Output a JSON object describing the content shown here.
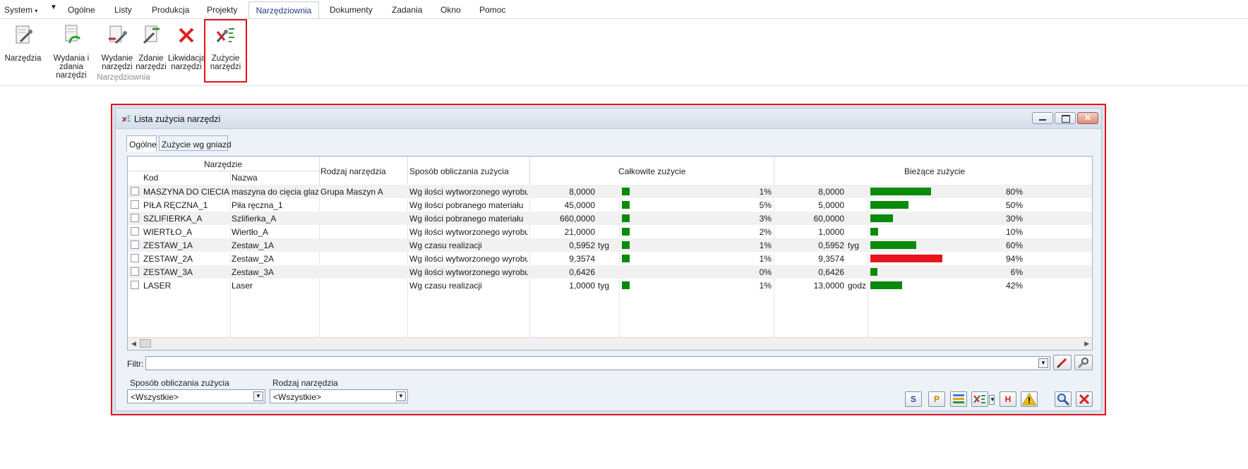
{
  "menu": {
    "system": "System",
    "items": [
      "Ogólne",
      "Listy",
      "Produkcja",
      "Projekty",
      "Narzędziownia",
      "Dokumenty",
      "Zadania",
      "Okno",
      "Pomoc"
    ]
  },
  "ribbon": {
    "buttons": [
      {
        "line1": "Narzędzia",
        "line2": ""
      },
      {
        "line1": "Wydania i",
        "line2": "zdania narzędzi"
      },
      {
        "line1": "Wydanie",
        "line2": "narzędzi"
      },
      {
        "line1": "Zdanie",
        "line2": "narzędzi"
      },
      {
        "line1": "Likwidacja",
        "line2": "narzędzi"
      },
      {
        "line1": "Zużycie",
        "line2": "narzędzi"
      }
    ],
    "group_label": "Narzędziownia"
  },
  "window": {
    "title": "Lista zużycia narzędzi",
    "tabs": [
      "Ogólne",
      "Zużycie wg gniazd"
    ],
    "columns": {
      "group": "Narzędzie",
      "kod": "Kod",
      "nazwa": "Nazwa",
      "rodzaj": "Rodzaj narzędzia",
      "sposob": "Sposób obliczania zużycia",
      "calkowite": "Całkowite zużycie",
      "biezace": "Bieżące zużycie"
    },
    "rows": [
      {
        "kod": "MASZYNA DO CIECIA GL",
        "nazwa": "maszyna do cięcia glazur",
        "rodzaj": "Grupa Maszyn A",
        "sposob": "Wg ilości wytworzonego wyrobu",
        "calk_val": "8,0000",
        "calk_unit": "",
        "calk_pct": "1%",
        "calk_frac": 0.01,
        "calk_color": "#0a8a0a",
        "biez_val": "8,0000",
        "biez_unit": "",
        "biez_pct": "80%",
        "biez_frac": 0.8,
        "biez_color": "#0a8a0a"
      },
      {
        "kod": "PIŁA RĘCZNA_1",
        "nazwa": "Piła ręczna_1",
        "rodzaj": "",
        "sposob": "Wg ilości pobranego materiału",
        "calk_val": "45,0000",
        "calk_unit": "",
        "calk_pct": "5%",
        "calk_frac": 0.05,
        "calk_color": "#0a8a0a",
        "biez_val": "5,0000",
        "biez_unit": "",
        "biez_pct": "50%",
        "biez_frac": 0.5,
        "biez_color": "#0a8a0a"
      },
      {
        "kod": "SZLIFIERKA_A",
        "nazwa": "Szlifierka_A",
        "rodzaj": "",
        "sposob": "Wg ilości pobranego materiału",
        "calk_val": "660,0000",
        "calk_unit": "",
        "calk_pct": "3%",
        "calk_frac": 0.03,
        "calk_color": "#0a8a0a",
        "biez_val": "60,0000",
        "biez_unit": "",
        "biez_pct": "30%",
        "biez_frac": 0.3,
        "biez_color": "#0a8a0a"
      },
      {
        "kod": "WIERTŁO_A",
        "nazwa": "Wiertło_A",
        "rodzaj": "",
        "sposob": "Wg ilości wytworzonego wyrobu",
        "calk_val": "21,0000",
        "calk_unit": "",
        "calk_pct": "2%",
        "calk_frac": 0.02,
        "calk_color": "#0a8a0a",
        "biez_val": "1,0000",
        "biez_unit": "",
        "biez_pct": "10%",
        "biez_frac": 0.1,
        "biez_color": "#0a8a0a"
      },
      {
        "kod": "ZESTAW_1A",
        "nazwa": "Zestaw_1A",
        "rodzaj": "",
        "sposob": "Wg czasu realizacji",
        "calk_val": "0,5952",
        "calk_unit": "tyg",
        "calk_pct": "1%",
        "calk_frac": 0.01,
        "calk_color": "#0a8a0a",
        "biez_val": "0,5952",
        "biez_unit": "tyg",
        "biez_pct": "60%",
        "biez_frac": 0.6,
        "biez_color": "#0a8a0a"
      },
      {
        "kod": "ZESTAW_2A",
        "nazwa": "Zestaw_2A",
        "rodzaj": "",
        "sposob": "Wg ilości wytworzonego wyrobu",
        "calk_val": "9,3574",
        "calk_unit": "",
        "calk_pct": "1%",
        "calk_frac": 0.01,
        "calk_color": "#0a8a0a",
        "biez_val": "9,3574",
        "biez_unit": "",
        "biez_pct": "94%",
        "biez_frac": 0.94,
        "biez_color": "#e8141b"
      },
      {
        "kod": "ZESTAW_3A",
        "nazwa": "Zestaw_3A",
        "rodzaj": "",
        "sposob": "Wg ilości wytworzonego wyrobu",
        "calk_val": "0,6426",
        "calk_unit": "",
        "calk_pct": "0%",
        "calk_frac": 0.0,
        "calk_color": "#0a8a0a",
        "biez_val": "0,6426",
        "biez_unit": "",
        "biez_pct": "6%",
        "biez_frac": 0.06,
        "biez_color": "#0a8a0a"
      },
      {
        "kod": "LASER",
        "nazwa": "Laser",
        "rodzaj": "",
        "sposob": "Wg czasu realizacji",
        "calk_val": "1,0000",
        "calk_unit": "tyg",
        "calk_pct": "1%",
        "calk_frac": 0.01,
        "calk_color": "#0a8a0a",
        "biez_val": "13,0000",
        "biez_unit": "godz",
        "biez_pct": "42%",
        "biez_frac": 0.42,
        "biez_color": "#0a8a0a"
      }
    ],
    "filter_label": "Filtr:",
    "filter_value": "",
    "bottom": {
      "sposob_label": "Sposób obliczania zużycia",
      "sposob_value": "<Wszystkie>",
      "rodzaj_label": "Rodzaj narzędzia",
      "rodzaj_value": "<Wszystkie>"
    },
    "toolbar_letters": {
      "s": "S",
      "p": "P",
      "h": "H"
    }
  }
}
